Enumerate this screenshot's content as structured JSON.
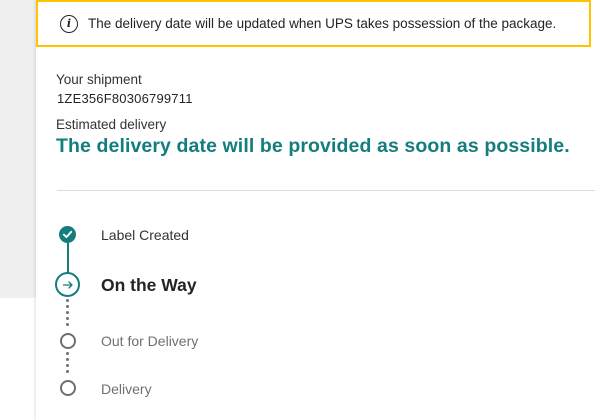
{
  "alert": {
    "icon": "info-icon",
    "text": "The delivery date will be updated when UPS takes possession of the package."
  },
  "shipment": {
    "label": "Your shipment",
    "tracking_number": "1ZE356F80306799711",
    "estimated_label": "Estimated delivery",
    "estimated_value": "The delivery date will be provided as soon as possible."
  },
  "progress": {
    "steps": [
      {
        "label": "Label Created",
        "status": "complete"
      },
      {
        "label": "On the Way",
        "status": "current"
      },
      {
        "label": "Out for Delivery",
        "status": "pending"
      },
      {
        "label": "Delivery",
        "status": "pending"
      }
    ]
  },
  "colors": {
    "accent": "#147d7d",
    "alert_border": "#ffc400",
    "pending": "#6f6f6f"
  }
}
